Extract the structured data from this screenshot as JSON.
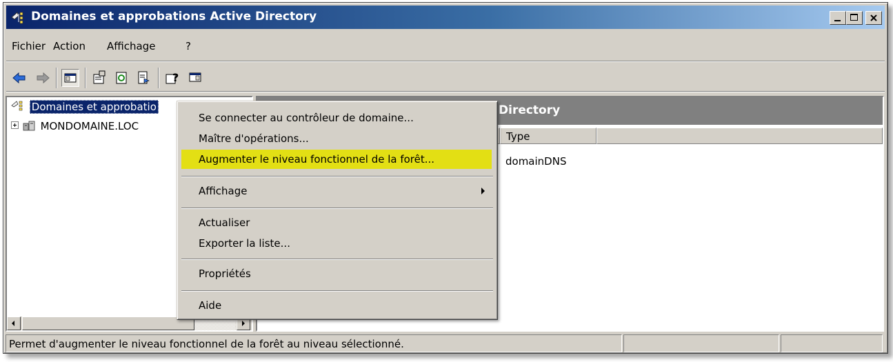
{
  "window": {
    "title": "Domaines et approbations Active Directory"
  },
  "menubar": {
    "items": [
      "Fichier",
      "Action",
      "Affichage",
      "?"
    ]
  },
  "tree": {
    "root_label": "Domaines et approbatio",
    "child_label": "MONDOMAINE.LOC"
  },
  "right_pane": {
    "header": "Directory",
    "columns": [
      "Type"
    ],
    "rows": [
      [
        "domainDNS"
      ]
    ]
  },
  "context_menu": {
    "items": [
      "Se connecter au contrôleur de domaine...",
      "Maître d'opérations...",
      "Augmenter le niveau fonctionnel de la forêt...",
      "Affichage",
      "Actualiser",
      "Exporter la liste...",
      "Propriétés",
      "Aide"
    ],
    "highlighted_index": 2,
    "highlight_color": "#e3df14"
  },
  "statusbar": {
    "text": "Permet d'augmenter le niveau fonctionnel de la forêt au niveau sélectionné."
  },
  "colors": {
    "title_start": "#0a246a",
    "title_end": "#a6caf0",
    "face": "#d4d0c8",
    "pane_header": "#808080"
  }
}
